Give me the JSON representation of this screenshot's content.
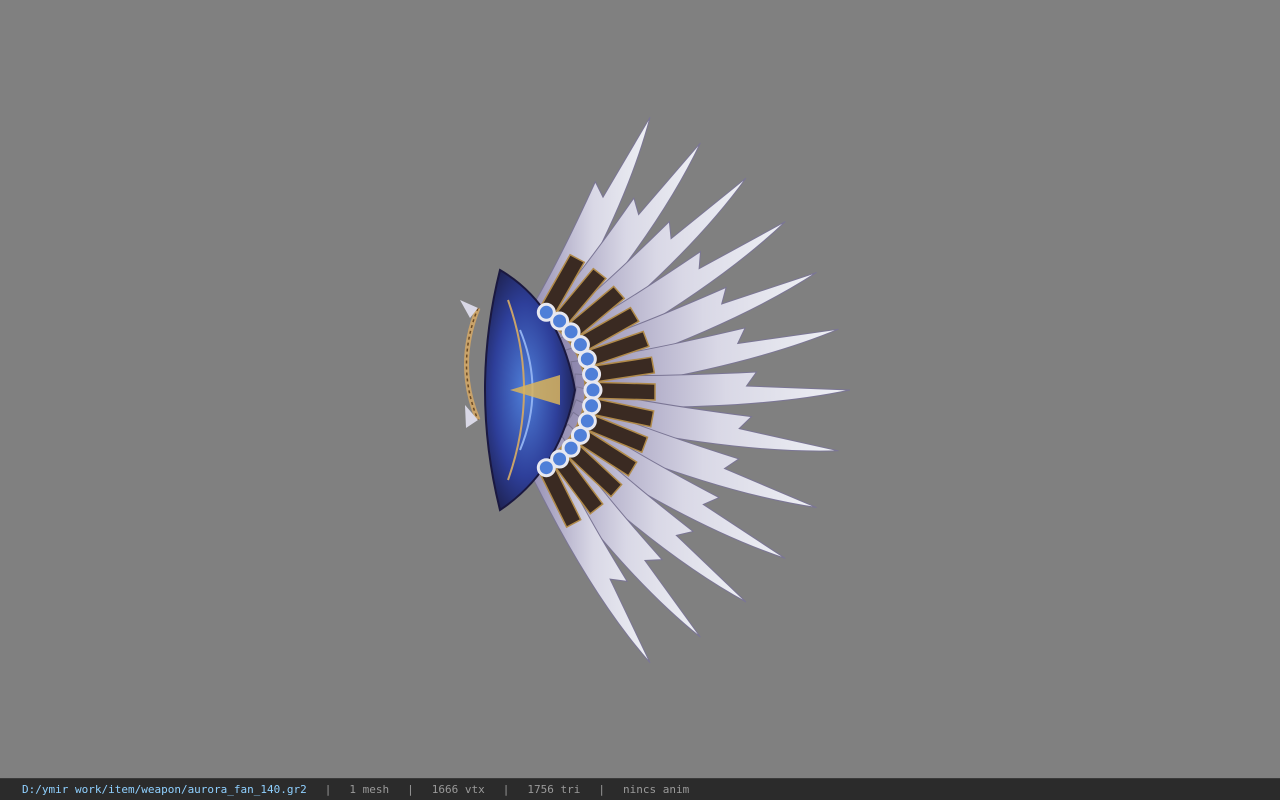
{
  "viewport": {
    "background": "#808080",
    "model": {
      "icon": "aurora-fan-weapon-model",
      "palette": {
        "blade_light": "#e8e8f0",
        "blade_mid": "#b9b6cf",
        "blade_shadow": "#7a7594",
        "panel_dark": "#3a2a22",
        "panel_gold": "#b08a4a",
        "core_blue": "#2e3f9a",
        "core_bright": "#4f7fd8",
        "handle_rope": "#c9a36a"
      }
    }
  },
  "statusbar": {
    "file_path": "D:/ymir work/item/weapon/aurora_fan_140.gr2",
    "separator": "|",
    "mesh_count": "1 mesh",
    "vertex_count": "1666 vtx",
    "triangle_count": "1756 tri",
    "anim_status": "nincs anim",
    "colors": {
      "background": "#2b2b2b",
      "path_text": "#8fd0ff",
      "info_text": "#9a9a9a"
    }
  }
}
